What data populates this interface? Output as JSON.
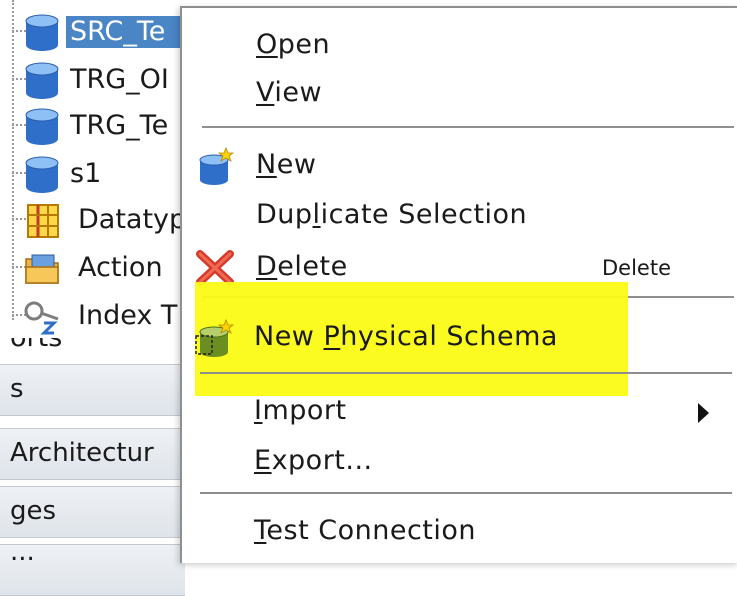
{
  "tree": {
    "items": [
      {
        "label": "SRC_Te",
        "icon": "database-icon",
        "selected": true
      },
      {
        "label": "TRG_OI",
        "icon": "database-icon"
      },
      {
        "label": "TRG_Te",
        "icon": "database-icon"
      },
      {
        "label": "s1",
        "icon": "database-icon"
      },
      {
        "label": "Datatyp",
        "icon": "datatype-grid-icon"
      },
      {
        "label": "Action",
        "icon": "folder-icon"
      },
      {
        "label": "Index T",
        "icon": "key-icon"
      }
    ],
    "partial_label": "orts",
    "sections": [
      "s",
      "Architectur",
      "ges",
      "..."
    ]
  },
  "menu": {
    "items": [
      {
        "label": "Open",
        "mnemonic": "O"
      },
      {
        "label": "View",
        "mnemonic": "V"
      },
      {
        "label": "New",
        "mnemonic": "N",
        "icon": "new-database-icon"
      },
      {
        "label": "Duplicate Selection",
        "mnemonic": "l"
      },
      {
        "label": "Delete",
        "mnemonic": "D",
        "icon": "delete-x-icon",
        "accelerator": "Delete"
      },
      {
        "label": "New Physical Schema",
        "mnemonic": "P",
        "icon": "physical-schema-icon",
        "highlighted": true
      },
      {
        "label": "Import",
        "mnemonic": "I",
        "submenu": true
      },
      {
        "label": "Export...",
        "mnemonic": "E"
      },
      {
        "label": "Test Connection",
        "mnemonic": "T"
      }
    ]
  },
  "colors": {
    "highlight": "#fbfb16",
    "selection": "#4a86c5",
    "delete_icon": "#d63b2a"
  }
}
